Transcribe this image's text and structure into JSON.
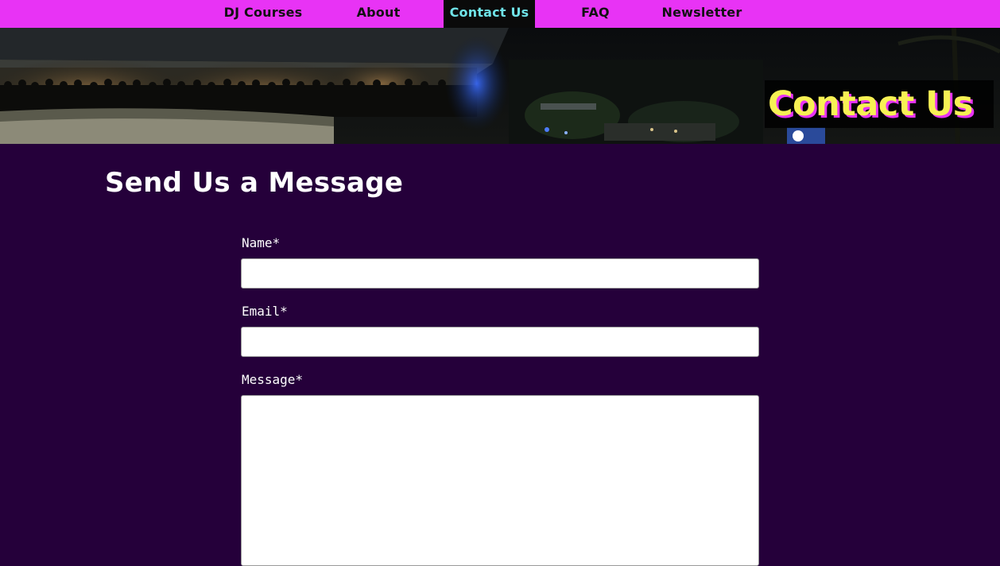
{
  "nav": {
    "items": [
      {
        "label": "DJ Courses"
      },
      {
        "label": "About"
      },
      {
        "label": "Contact Us",
        "active": true
      },
      {
        "label": "FAQ"
      },
      {
        "label": "Newsletter"
      }
    ]
  },
  "hero": {
    "title": "Contact Us"
  },
  "form": {
    "heading": "Send Us a Message",
    "fields": [
      {
        "label": "Name*",
        "value": ""
      },
      {
        "label": "Email*",
        "value": ""
      },
      {
        "label": "Message*",
        "value": ""
      }
    ]
  },
  "colors": {
    "nav_bg": "#e833f5",
    "active_bg": "#0a0a0a",
    "active_text": "#6fe3e8",
    "page_bg": "#25003a",
    "hero_title": "#f7f154",
    "hero_title_shadow": "#e833f5"
  }
}
